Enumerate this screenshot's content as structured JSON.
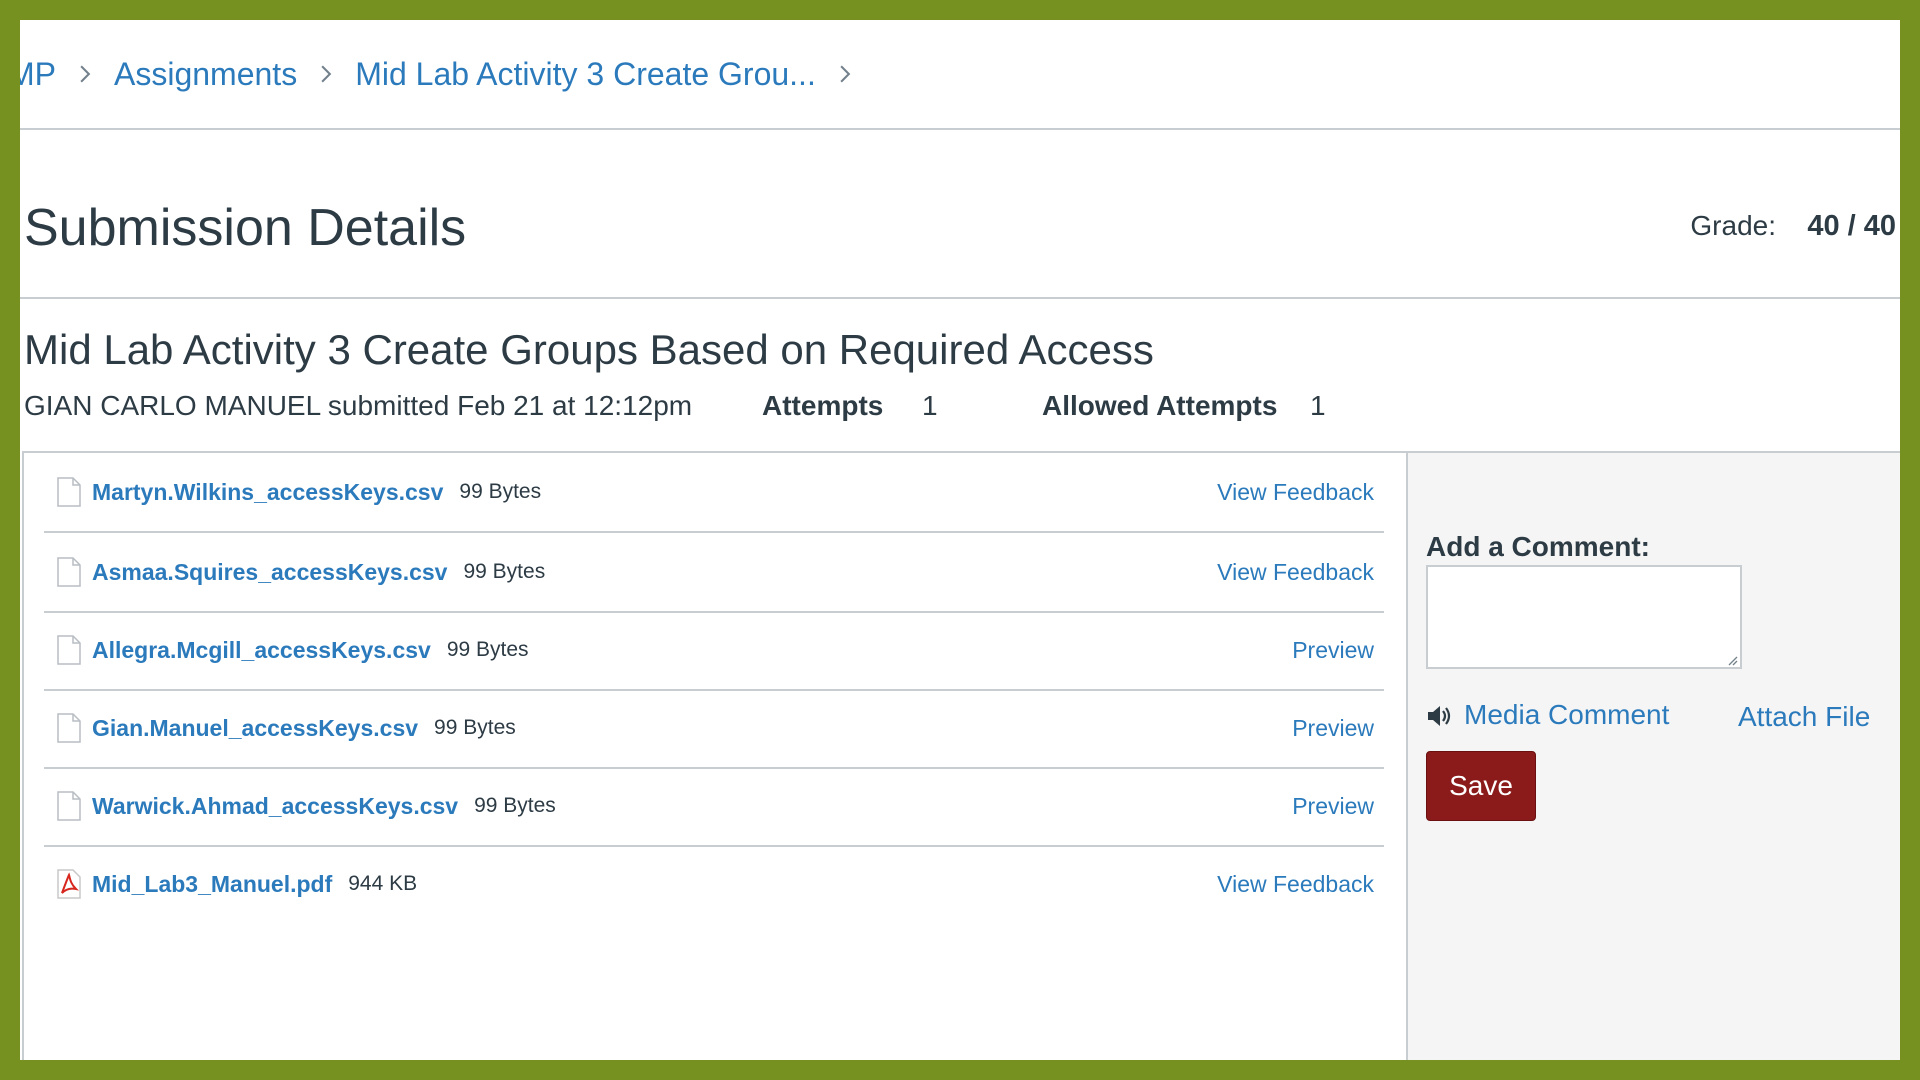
{
  "breadcrumb": {
    "items": [
      "MP",
      "Assignments",
      "Mid Lab Activity 3 Create Grou..."
    ]
  },
  "header": {
    "title": "Submission Details",
    "grade_label": "Grade:",
    "grade_value": "40 / 40"
  },
  "assignment": {
    "title": "Mid Lab Activity 3 Create Groups Based on Required Access",
    "submitted_text": "GIAN CARLO MANUEL submitted Feb 21 at 12:12pm",
    "attempts_label": "Attempts",
    "attempts_value": "1",
    "allowed_label": "Allowed Attempts",
    "allowed_value": "1"
  },
  "files": [
    {
      "name": "Martyn.Wilkins_accessKeys.csv",
      "size": "99 Bytes",
      "action": "View Feedback",
      "icon": "document-icon"
    },
    {
      "name": "Asmaa.Squires_accessKeys.csv",
      "size": "99 Bytes",
      "action": "View Feedback",
      "icon": "document-icon"
    },
    {
      "name": "Allegra.Mcgill_accessKeys.csv",
      "size": "99 Bytes",
      "action": "Preview",
      "icon": "document-icon"
    },
    {
      "name": "Gian.Manuel_accessKeys.csv",
      "size": "99 Bytes",
      "action": "Preview",
      "icon": "document-icon"
    },
    {
      "name": "Warwick.Ahmad_accessKeys.csv",
      "size": "99 Bytes",
      "action": "Preview",
      "icon": "document-icon"
    },
    {
      "name": "Mid_Lab3_Manuel.pdf",
      "size": "944 KB",
      "action": "View Feedback",
      "icon": "pdf-icon"
    }
  ],
  "comment": {
    "label": "Add a Comment:",
    "value": "",
    "media_label": "Media Comment",
    "attach_label": "Attach File",
    "save_label": "Save"
  },
  "colors": {
    "link": "#2b7abc",
    "text": "#2d3b45",
    "save_button": "#8b1a1a",
    "frame_border": "#76911f"
  }
}
